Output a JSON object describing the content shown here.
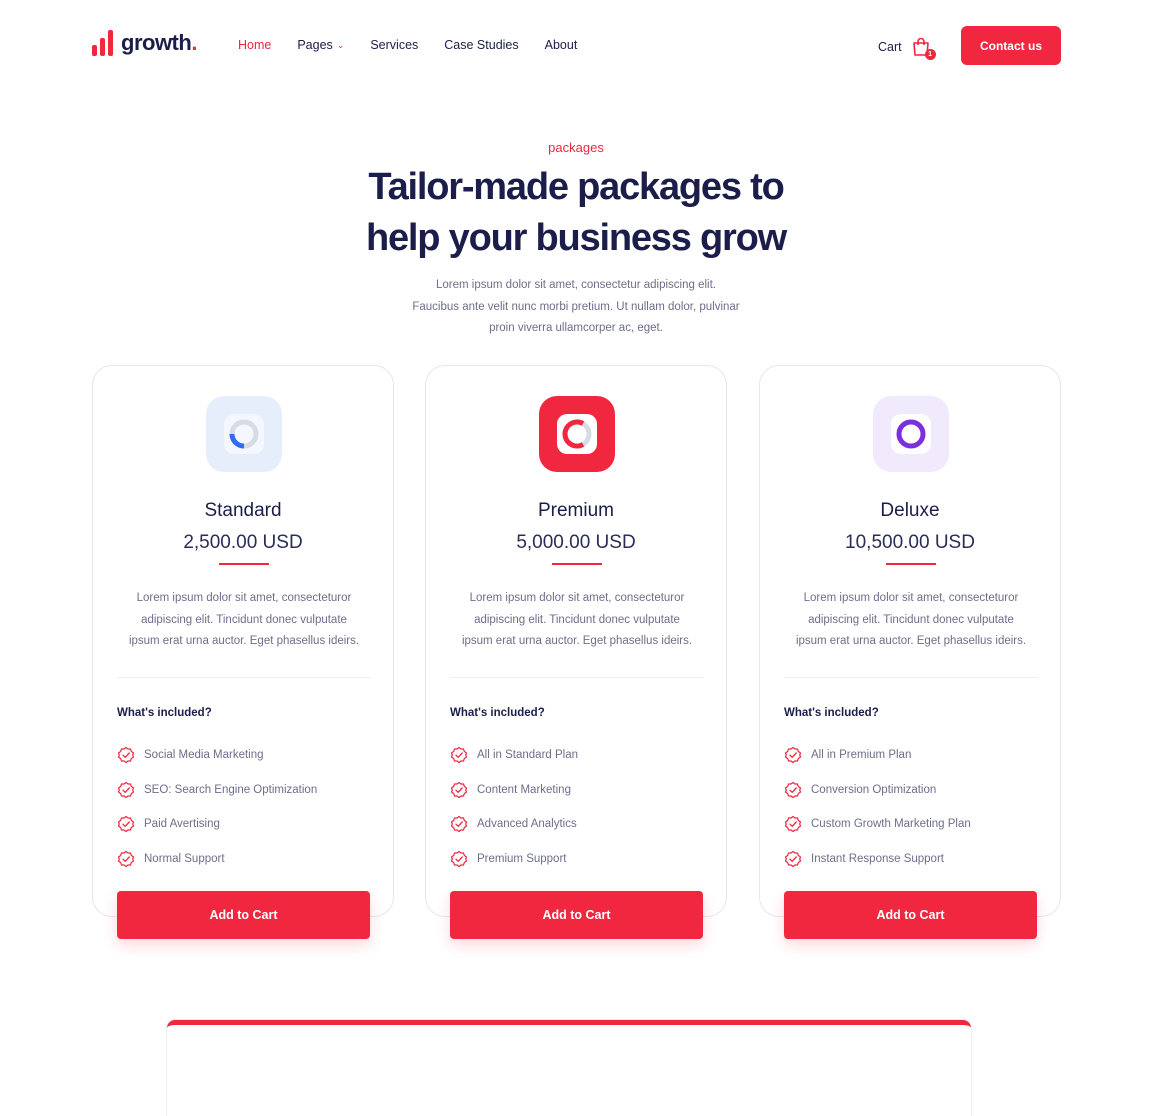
{
  "brand": {
    "name": "growth",
    "dot": "."
  },
  "nav": {
    "items": [
      {
        "label": "Home",
        "active": true
      },
      {
        "label": "Pages",
        "active": false,
        "has_dropdown": true
      },
      {
        "label": "Services",
        "active": false
      },
      {
        "label": "Case Studies",
        "active": false
      },
      {
        "label": "About",
        "active": false
      }
    ],
    "cart_label": "Cart",
    "cart_count": "1",
    "contact_label": "Contact us"
  },
  "hero": {
    "eyebrow": "packages",
    "title_line1": "Tailor-made packages to",
    "title_line2": "help your business grow",
    "subtitle_line1": "Lorem ipsum dolor sit amet, consectetur adipiscing elit.",
    "subtitle_line2": "Faucibus ante velit nunc morbi pretium. Ut nullam dolor, pulvinar",
    "subtitle_line3": "proin viverra ullamcorper ac, eget."
  },
  "plans": [
    {
      "name": "Standard",
      "price": "2,500.00 USD",
      "desc_line1": "Lorem ipsum dolor sit amet, consecteturor",
      "desc_line2": "adipiscing elit. Tincidunt donec vulputate",
      "desc_line3": "ipsum erat urna auctor. Eget phasellus ideirs.",
      "included_label": "What's included?",
      "features": [
        "Social Media Marketing",
        "SEO: Search Engine Optimization",
        "Paid Avertising",
        "Normal Support"
      ],
      "button_label": "Add to Cart",
      "icon": "standard-plan-icon"
    },
    {
      "name": "Premium",
      "price": "5,000.00 USD",
      "desc_line1": "Lorem ipsum dolor sit amet, consecteturor",
      "desc_line2": "adipiscing elit. Tincidunt donec vulputate",
      "desc_line3": "ipsum erat urna auctor. Eget phasellus ideirs.",
      "included_label": "What's included?",
      "features": [
        "All in Standard Plan",
        "Content Marketing",
        "Advanced Analytics",
        "Premium Support"
      ],
      "button_label": "Add to Cart",
      "icon": "premium-plan-icon"
    },
    {
      "name": "Deluxe",
      "price": "10,500.00 USD",
      "desc_line1": "Lorem ipsum dolor sit amet, consecteturor",
      "desc_line2": "adipiscing elit. Tincidunt donec vulputate",
      "desc_line3": "ipsum erat urna auctor. Eget phasellus ideirs.",
      "included_label": "What's included?",
      "features": [
        "All in Premium Plan",
        "Conversion Optimization",
        "Custom Growth Marketing Plan",
        "Instant Response Support"
      ],
      "button_label": "Add to Cart",
      "icon": "deluxe-plan-icon"
    }
  ],
  "colors": {
    "accent": "#f1263f",
    "navy": "#1b1d4a",
    "muted": "#6c6f8a",
    "blue": "#2f6df6",
    "purple": "#7b2fe0"
  }
}
